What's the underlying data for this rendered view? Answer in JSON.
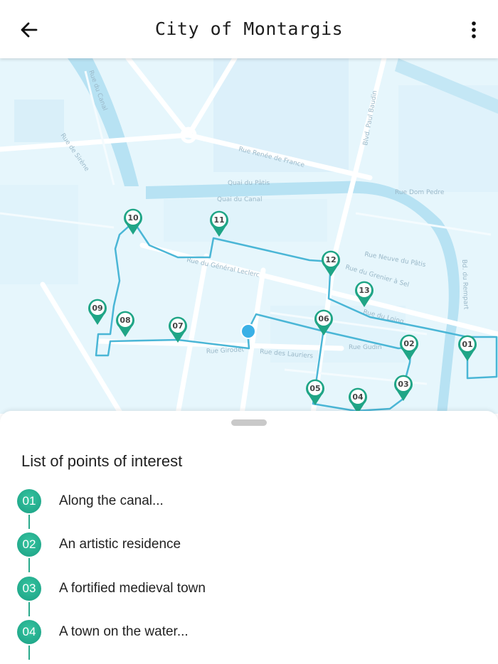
{
  "header": {
    "title": "City of Montargis",
    "back_icon": "arrow-left-icon",
    "more_icon": "more-vertical-icon"
  },
  "map": {
    "streets": [
      "Rue Renée de France",
      "Quai du Pâtis",
      "Quai du Canal",
      "Rue Dom Pedre",
      "Rue Neuve du Pâtis",
      "Rue du Grenier à Sel",
      "Rue du Loing",
      "Rue Gudin",
      "Rue des Lauriers",
      "Rue Girodet",
      "Rue du Général Leclerc",
      "Rue de Sirène",
      "Bd. du Rempart",
      "Blvd. Paul Baudin",
      "Rue du Canal"
    ],
    "pins": [
      "01",
      "02",
      "03",
      "04",
      "05",
      "06",
      "07",
      "08",
      "09",
      "10",
      "11",
      "12",
      "13"
    ],
    "location_marker": "current-location"
  },
  "sheet": {
    "title": "List of points of interest",
    "items": [
      {
        "num": "01",
        "label": "Along the canal..."
      },
      {
        "num": "02",
        "label": "An artistic residence"
      },
      {
        "num": "03",
        "label": "A fortified medieval town"
      },
      {
        "num": "04",
        "label": "A town on the water..."
      }
    ]
  },
  "colors": {
    "accent": "#1fa586",
    "route": "#4ab6d6",
    "map_bg": "#e4f6fd"
  }
}
